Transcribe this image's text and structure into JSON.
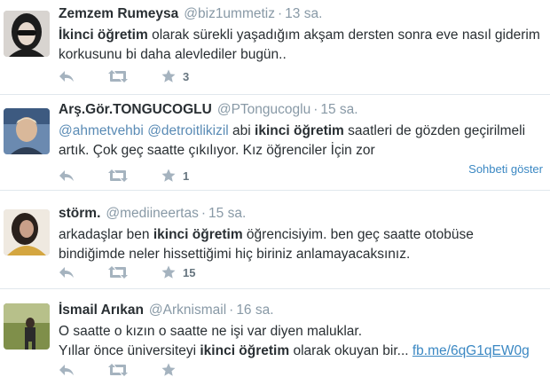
{
  "tweets": [
    {
      "fullname": "Zemzem Rumeysa",
      "username": "@biz1ummetiz",
      "time": "13 sa.",
      "text_parts": [
        "İkinci öğretim",
        " olarak sürekli yaşadığım  akşam dersten sonra eve nasıl giderim korkusunu bi daha alevlediler bugün.."
      ],
      "favorite_count": "3"
    },
    {
      "fullname": "Arş.Gör.TONGUCOGLU",
      "username": "@PTongucoglu",
      "time": "15 sa.",
      "text_parts": [
        "@ahmetvehbi",
        " ",
        "@detroitlikizil",
        " abi ",
        "ikinci öğretim",
        " saatleri de gözden geçirilmeli artık. Çok geç saatte çıkılıyor. Kız öğrenciler İçin zor"
      ],
      "favorite_count": "1",
      "conversation_link": "Sohbeti göster"
    },
    {
      "fullname": "störm.",
      "username": "@mediineertas",
      "time": "15 sa.",
      "text_parts": [
        "arkadaşlar ben ",
        "ikinci öğretim",
        " öğrencisiyim. ben geç saatte otobüse bindiğimde neler hissettiğimi hiç biriniz anlamayacaksınız."
      ],
      "favorite_count": "15"
    },
    {
      "fullname": "İsmail Arıkan",
      "username": "@Arknismail",
      "time": "16 sa.",
      "text_parts": [
        "O saatte o kızın o saatte ne işi var diyen maluklar.",
        "Yıllar önce üniversiteyi ",
        "ikinci öğretim",
        " olarak okuyan bir... ",
        "fb.me/6qG1qEW0g"
      ],
      "favorite_count": ""
    }
  ],
  "separator": "·",
  "icons": [
    "reply-icon",
    "retweet-icon",
    "favorite-icon"
  ]
}
